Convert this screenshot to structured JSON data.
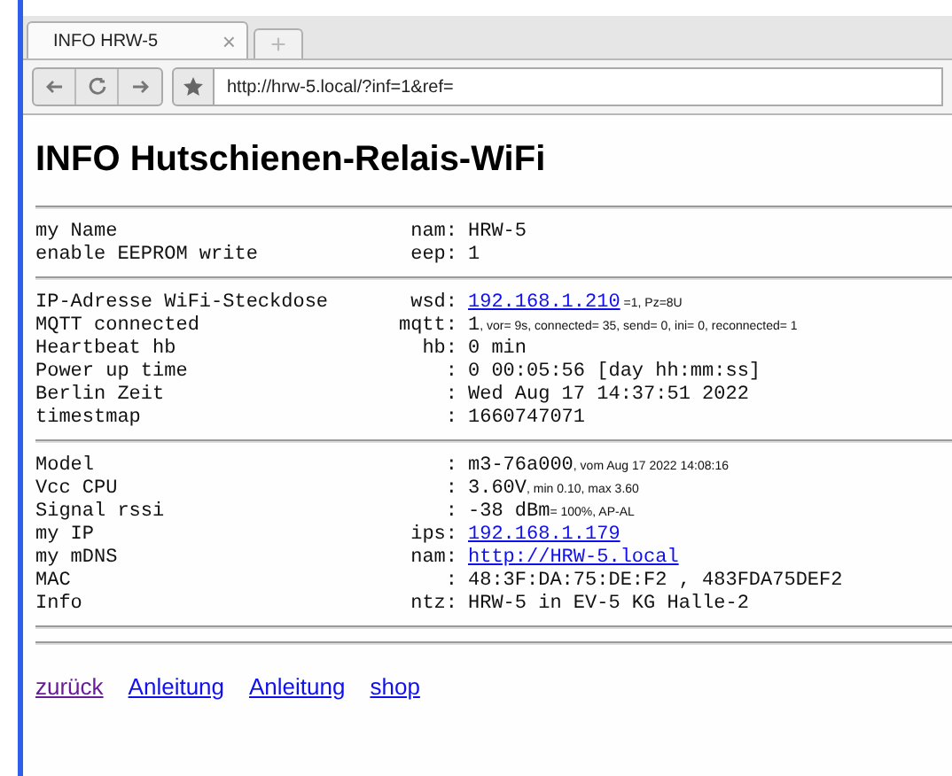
{
  "browser": {
    "tab": {
      "title": "INFO HRW-5",
      "close": "×",
      "new_tab": "+"
    },
    "url": "http://hrw-5.local/?inf=1&ref="
  },
  "title": "INFO Hutschienen-Relais-WiFi",
  "sections": [
    [
      {
        "label": "my Name",
        "key": "nam:",
        "value": "HRW-5"
      },
      {
        "label": "enable EEPROM write",
        "key": "eep:",
        "value": "1"
      }
    ],
    [
      {
        "label": "IP-Adresse WiFi-Steckdose",
        "key": "wsd:",
        "link": "192.168.1.210",
        "note": " =1, Pz=8U"
      },
      {
        "label": "MQTT connected",
        "key": "mqtt:",
        "value": "1",
        "note": ", vor= 9s, connected= 35, send= 0, ini= 0, reconnected= 1"
      },
      {
        "label": "Heartbeat hb",
        "key": "hb:",
        "value": "0 min"
      },
      {
        "label": "Power up time",
        "key": ":",
        "value": "0 00:05:56 [day hh:mm:ss]"
      },
      {
        "label": "Berlin Zeit",
        "key": ":",
        "value": "Wed Aug 17 14:37:51 2022"
      },
      {
        "label": "timestmap",
        "key": ":",
        "value": "1660747071"
      }
    ],
    [
      {
        "label": "Model",
        "key": ":",
        "value": "m3-76a000",
        "note": ", vom Aug 17 2022 14:08:16"
      },
      {
        "label": "Vcc CPU",
        "key": ":",
        "value": "3.60V",
        "note": ", min 0.10, max 3.60"
      },
      {
        "label": "Signal rssi",
        "key": ":",
        "value": "-38 dBm",
        "note": "= 100%, AP-AL"
      },
      {
        "label": "my IP",
        "key": "ips:",
        "link": "192.168.1.179"
      },
      {
        "label": "my mDNS",
        "key": "nam:",
        "link": "http://HRW-5.local"
      },
      {
        "label": "MAC",
        "key": ":",
        "value": "48:3F:DA:75:DE:F2 , 483FDA75DEF2"
      },
      {
        "label": "Info",
        "key": "ntz:",
        "value": "HRW-5 in EV-5 KG Halle-2"
      }
    ]
  ],
  "links": [
    {
      "label": "zurück",
      "visited": true
    },
    {
      "label": "Anleitung",
      "visited": false
    },
    {
      "label": "Anleitung",
      "visited": false
    },
    {
      "label": "shop",
      "visited": false
    }
  ]
}
